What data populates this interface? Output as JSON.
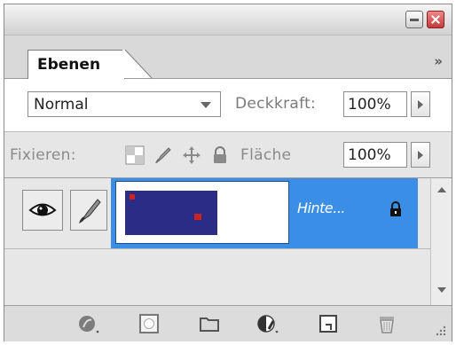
{
  "panel": {
    "tab_label": "Ebenen",
    "menu_glyph": "»"
  },
  "options": {
    "blend_mode": "Normal",
    "opacity_label": "Deckkraft:",
    "opacity_value": "100%"
  },
  "lock_row": {
    "label": "Fixieren:",
    "fill_label": "Fläche",
    "fill_value": "100%",
    "icons": [
      "lock-transparency-icon",
      "lock-image-icon",
      "lock-position-icon",
      "lock-all-icon"
    ]
  },
  "layers": [
    {
      "name": "Hinte...",
      "visible": true,
      "locked": true,
      "selected": true
    }
  ],
  "bottom_toolbar": {
    "icons": [
      "layer-style-icon",
      "layer-mask-icon",
      "new-group-icon",
      "adjustment-layer-icon",
      "new-layer-icon",
      "delete-layer-icon"
    ]
  },
  "colors": {
    "selection": "#3a8ee6",
    "thumbnail": "#2b2c86"
  }
}
